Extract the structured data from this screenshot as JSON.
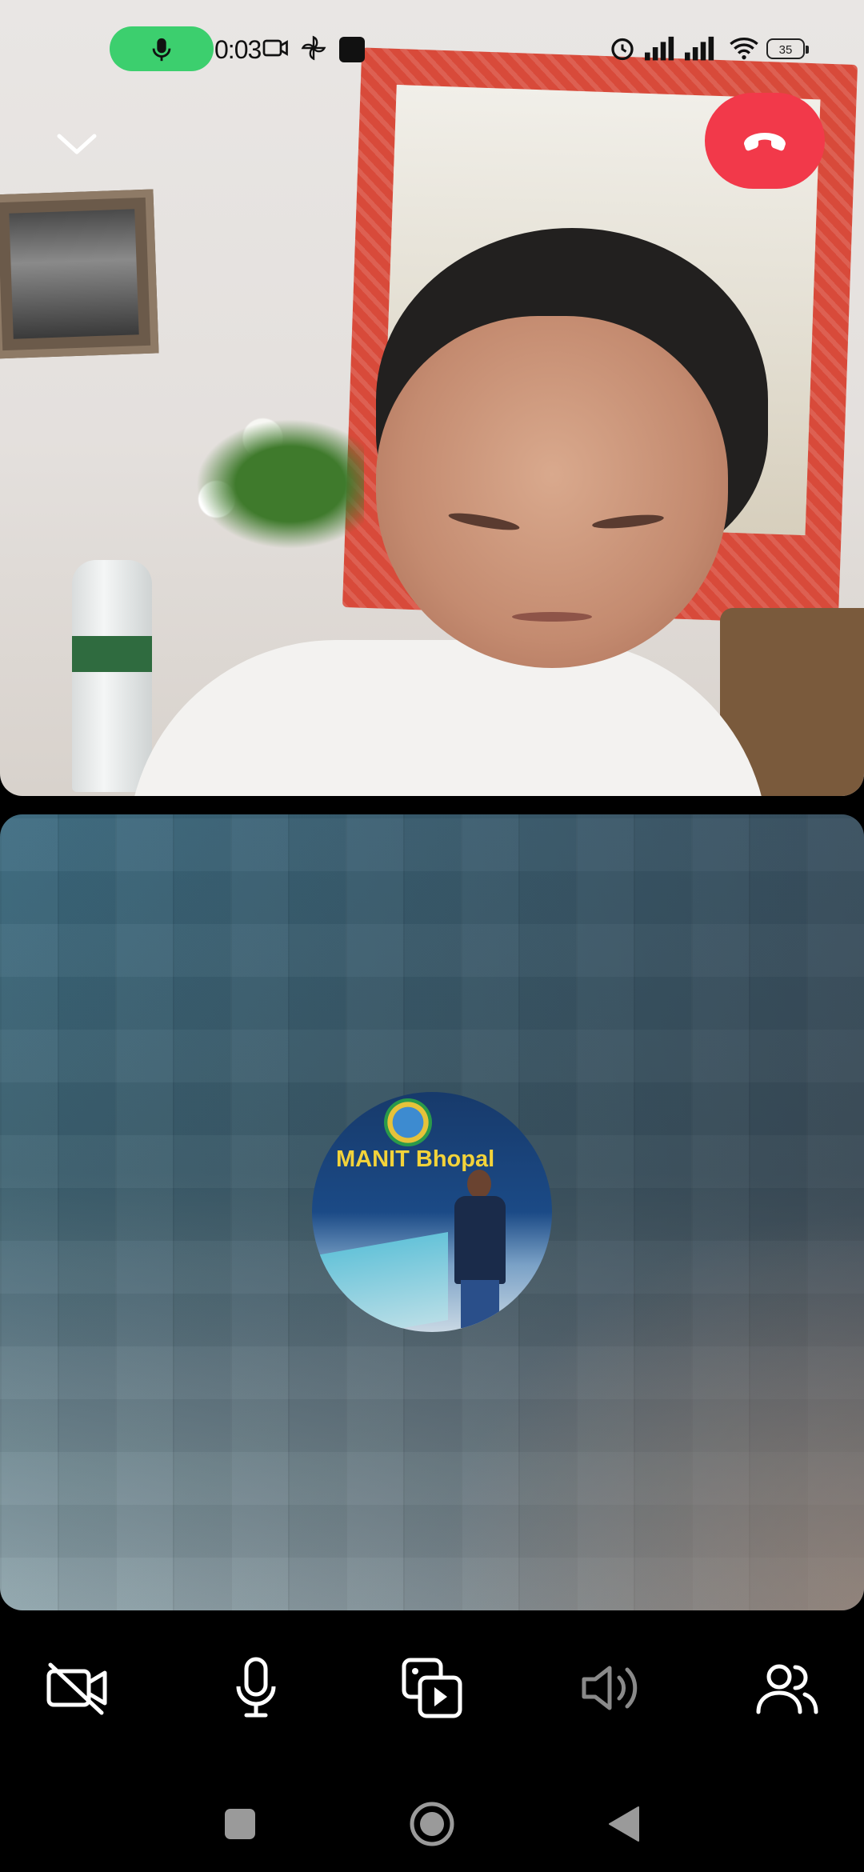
{
  "status_bar": {
    "time": "0:03",
    "battery": "35"
  },
  "call": {
    "local_profile_sign": "MANIT Bhopal"
  },
  "colors": {
    "end_call": "#f2394a",
    "mic_active": "#3ccf6e",
    "background": "#000000"
  },
  "icons": {
    "status_bar": [
      "microphone-icon",
      "video-camera-icon",
      "pinwheel-icon",
      "square-app-icon",
      "alarm-icon",
      "signal-icon",
      "signal-icon",
      "wifi-icon",
      "battery-icon"
    ],
    "top_controls": [
      "chevron-down-icon",
      "end-call-icon"
    ],
    "controls": [
      "video-off-icon",
      "microphone-icon",
      "media-share-icon",
      "speaker-icon",
      "participants-icon"
    ],
    "nav": [
      "recents-icon",
      "home-icon",
      "back-icon"
    ]
  }
}
